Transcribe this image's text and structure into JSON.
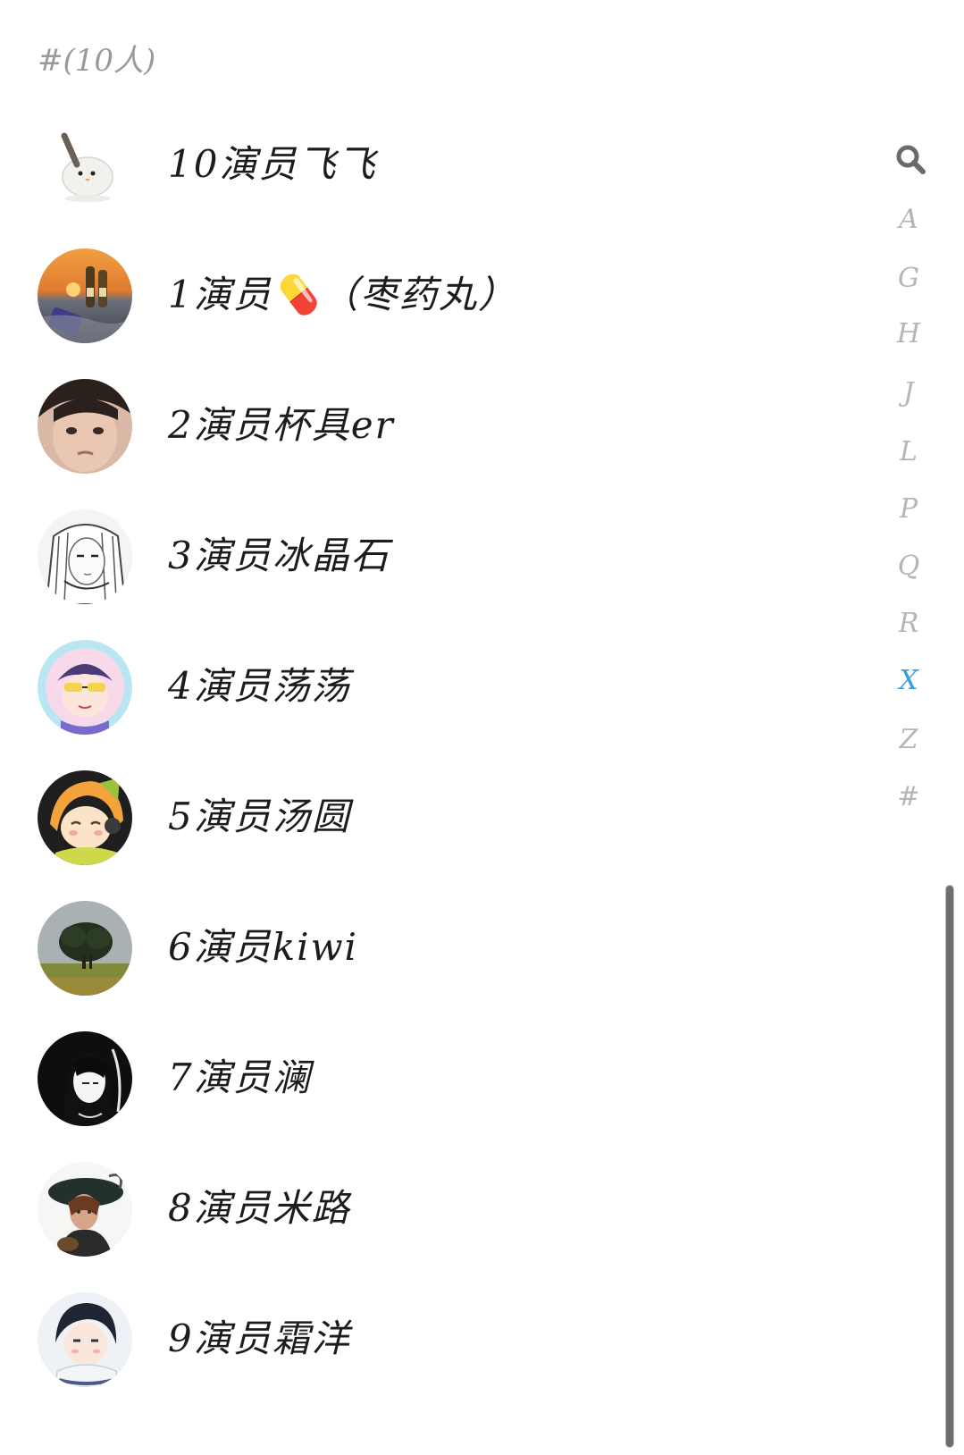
{
  "header": {
    "title": "#(10人)"
  },
  "contacts": [
    {
      "name": "10演员飞飞",
      "avatar": "bird-avatar-icon"
    },
    {
      "name": "1演员💊（枣药丸）",
      "avatar": "sunset-bottles-avatar-icon"
    },
    {
      "name": "2演员杯具er",
      "avatar": "child-face-avatar-icon"
    },
    {
      "name": "3演员冰晶石",
      "avatar": "manga-girl-avatar-icon"
    },
    {
      "name": "4演员荡荡",
      "avatar": "anime-boy-glasses-avatar-icon"
    },
    {
      "name": "5演员汤圆",
      "avatar": "anime-headphones-avatar-icon"
    },
    {
      "name": "6演员kiwi",
      "avatar": "tree-field-avatar-icon"
    },
    {
      "name": "7演员澜",
      "avatar": "dark-hair-girl-avatar-icon"
    },
    {
      "name": "8演员米路",
      "avatar": "painted-lady-hat-avatar-icon"
    },
    {
      "name": "9演员霜洋",
      "avatar": "anime-scarf-boy-avatar-icon"
    }
  ],
  "index": {
    "search_icon": "search-icon",
    "letters": [
      "A",
      "G",
      "H",
      "J",
      "L",
      "P",
      "Q",
      "R",
      "X",
      "Z",
      "#"
    ],
    "active": "X",
    "active_color": "#3b9ed9",
    "inactive_color": "#b5b5b5"
  }
}
